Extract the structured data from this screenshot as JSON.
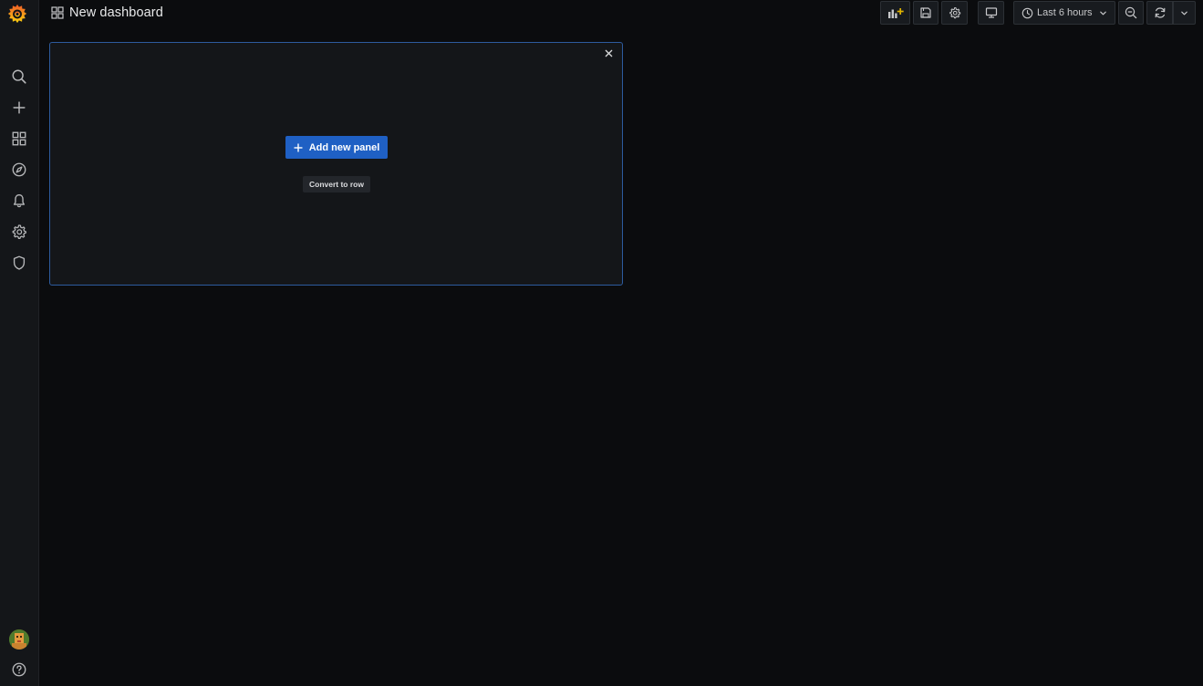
{
  "header": {
    "title": "New dashboard"
  },
  "toolbar": {
    "time_range": "Last 6 hours",
    "icons": [
      "add-panel-icon",
      "save-icon",
      "settings-icon",
      "tv-mode-icon",
      "clock-icon",
      "chevron-down-icon",
      "zoom-out-icon",
      "refresh-icon",
      "chevron-down-icon"
    ]
  },
  "sidebar": {
    "icons": [
      "grafana-logo",
      "search-icon",
      "plus-icon",
      "dashboards-icon",
      "explore-icon",
      "alerting-icon",
      "configuration-icon",
      "server-admin-icon",
      "avatar",
      "help-icon"
    ]
  },
  "panel": {
    "add_label": "Add new panel",
    "convert_label": "Convert to row"
  },
  "colors": {
    "background": "#0b0c0e",
    "sidebar": "#141619",
    "panel": "#141619",
    "panel_border": "#2d5b9e",
    "primary_button": "#1f60c4",
    "logo_orange": "#f46800"
  }
}
